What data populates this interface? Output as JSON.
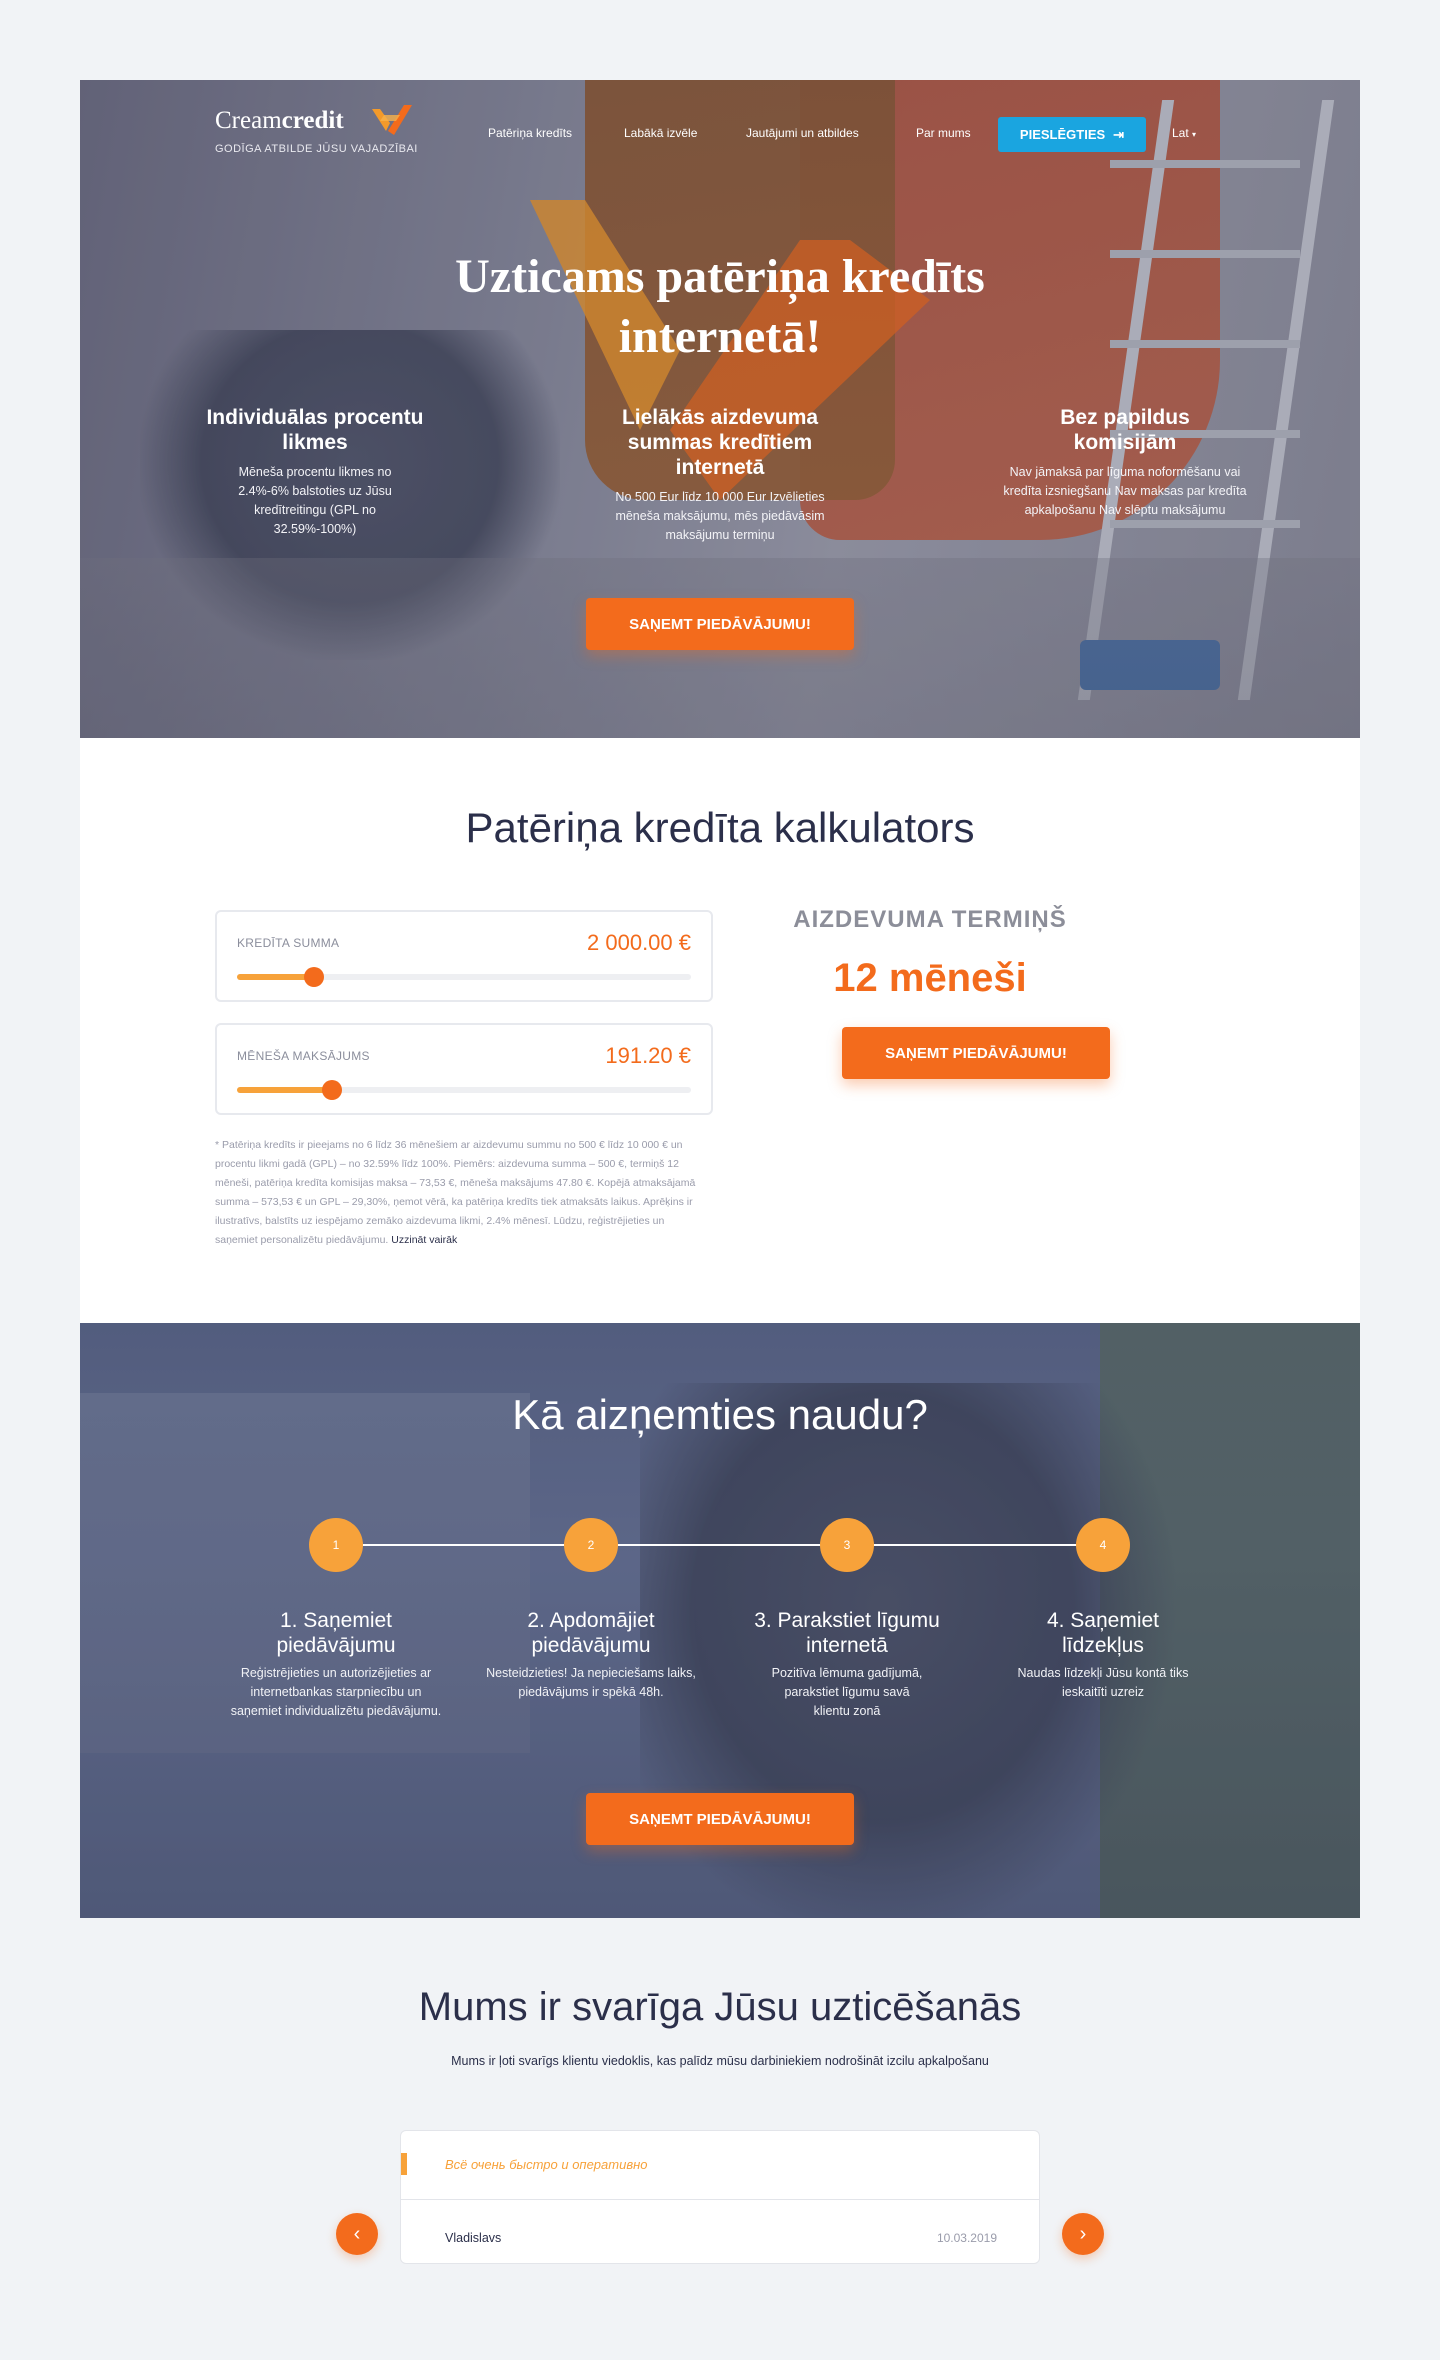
{
  "brand": {
    "name_light": "Cream",
    "name_bold": "credit",
    "tagline": "Godīga atbilde jūsu vajadzībai"
  },
  "nav": {
    "items": [
      "Patēriņa kredīts",
      "Labākā izvēle",
      "Jautājumi un atbildes",
      "Par mums"
    ],
    "login": "PIESLĒGTIES",
    "language": "Lat"
  },
  "hero": {
    "title": "Uzticams patēriņa kredīts internetā!",
    "features": [
      {
        "title": "Individuālas procentu likmes",
        "text": "Mēneša procentu likmes no 2.4%-6% balstoties uz Jūsu kredītreitingu (GPL no 32.59%-100%)"
      },
      {
        "title": "Lielākās aizdevuma summas kredītiem internetā",
        "text": "No 500 Eur līdz 10 000 Eur Izvēlieties mēneša maksājumu, mēs piedāvāsim maksājumu termiņu"
      },
      {
        "title": "Bez papildus komisijām",
        "text": "Nav jāmaksā par līguma noformēšanu vai kredīta izsniegšanu Nav maksas par kredīta apkalpošanu Nav slēptu maksājumu"
      }
    ],
    "cta": "SAŅEMT PIEDĀVĀJUMU!"
  },
  "calculator": {
    "title": "Patēriņa kredīta kalkulators",
    "amount": {
      "label": "KREDĪTA SUMMA",
      "value": "2 000.00  €",
      "fraction": 0.17
    },
    "monthly": {
      "label": "MĒNEŠA MAKSĀJUMS",
      "value": "191.20  €",
      "fraction": 0.21
    },
    "term_label": "AIZDEVUMA TERMIŅŠ",
    "term_value": "12 mēneši",
    "cta": "SAŅEMT PIEDĀVĀJUMU!",
    "disclaimer": "* Patēriņa kredīts ir pieejams no 6 līdz 36 mēnešiem ar aizdevumu summu no 500 € līdz 10 000 € un procentu likmi gadā (GPL) – no 32.59% līdz 100%. Piemērs: aizdevuma summa – 500 €, termiņš 12 mēneši, patēriņa kredīta komisijas maksa – 73,53 €, mēneša maksājums 47.80 €. Kopējā atmaksājamā summa – 573,53 € un GPL – 29,30%, ņemot vērā, ka patēriņa kredīts tiek atmaksāts laikus. Aprēķins ir ilustratīvs, balstīts uz iespējamo zemāko aizdevuma likmi, 2.4% mēnesī. Lūdzu, reģistrējieties un saņemiet personalizētu piedāvājumu.",
    "learn_more": "Uzzināt vairāk"
  },
  "how": {
    "title": "Kā aizņemties naudu?",
    "steps": [
      {
        "num": "1",
        "title": "1. Saņemiet piedāvājumu",
        "text": "Reģistrējieties un autorizējieties ar internetbankas starpniecību un saņemiet individualizētu piedāvājumu."
      },
      {
        "num": "2",
        "title": "2. Apdomājiet piedāvājumu",
        "text": "Nesteidzieties! Ja nepieciešams laiks, piedāvājums ir spēkā 48h."
      },
      {
        "num": "3",
        "title": "3. Parakstiet līgumu internetā",
        "text": "Pozitīva lēmuma gadījumā, parakstiet līgumu savā klientu zonā"
      },
      {
        "num": "4",
        "title": "4. Saņemiet līdzekļus",
        "text": "Naudas līdzekļi Jūsu kontā tiks ieskaitīti uzreiz"
      }
    ],
    "cta": "SAŅEMT PIEDĀVĀJUMU!"
  },
  "trust": {
    "title": "Mums ir svarīga Jūsu uzticēšanās",
    "subtitle": "Mums ir ļoti svarīgs klientu viedoklis, kas palīdz mūsu darbiniekiem nodrošināt izcilu apkalpošanu",
    "review": {
      "quote": "Всё очень быстро и оперативно",
      "author": "Vladislavs",
      "date": "10.03.2019"
    },
    "prev_icon": "chevron-left-icon",
    "next_icon": "chevron-right-icon"
  },
  "colors": {
    "accent": "#f36b1c",
    "accent_light": "#f7a23a",
    "login": "#1aa5e0",
    "text": "#2b2f4a"
  }
}
